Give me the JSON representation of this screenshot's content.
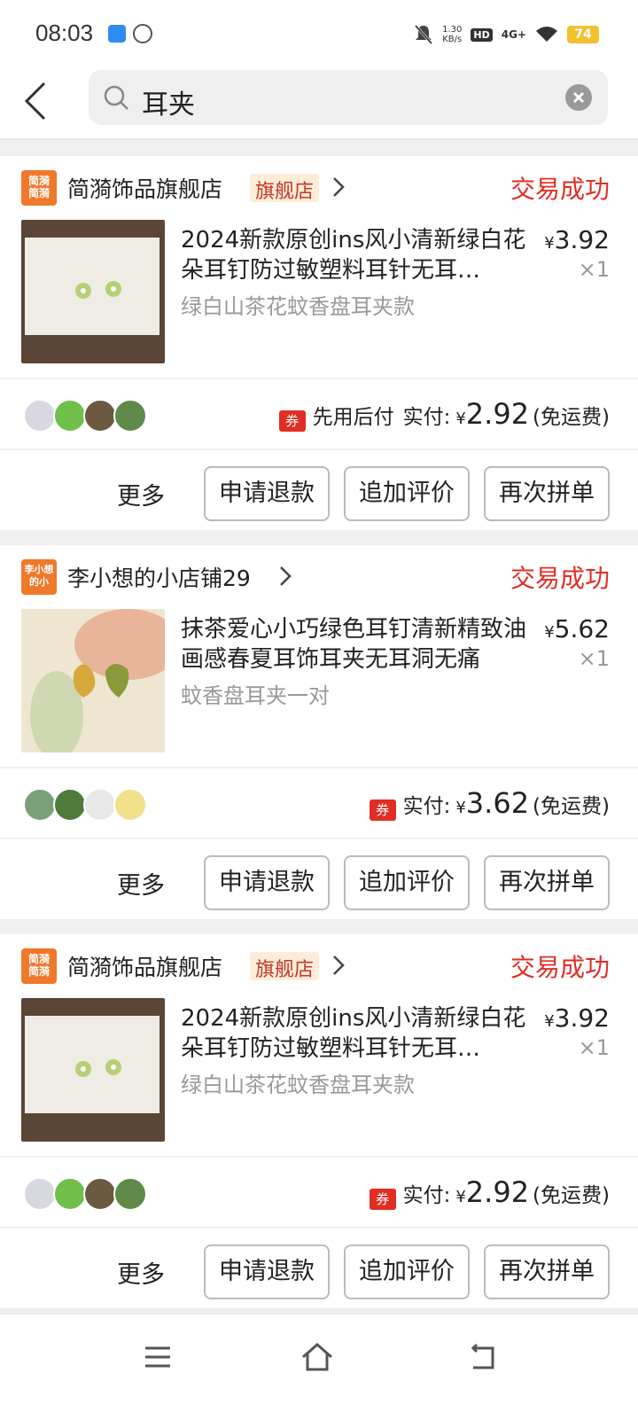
{
  "status_bar": {
    "time": "08:03",
    "net_speed_value": "1.30",
    "net_speed_unit": "KB/s",
    "hd": "HD",
    "network": "4G+",
    "battery": "74"
  },
  "header": {
    "search_text": "耳夹"
  },
  "orders": [
    {
      "shop_logo_text": "简漪简漪",
      "shop_name": "简漪饰品旗舰店",
      "badge": "旗舰店",
      "status": "交易成功",
      "title": "2024新款原创ins风小清新绿白花朵耳钉防过敏塑料耳针无耳…",
      "spec": "绿白山茶花蚊香盘耳夹款",
      "price": "3.92",
      "currency": "¥",
      "qty": "×1",
      "coupon": "券",
      "pay_later": "先用后付",
      "paid_label": "实付:",
      "paid_amount": "2.92",
      "free_shipping": "(免运费)"
    },
    {
      "shop_logo_text": "李小想的小",
      "shop_name": "李小想的小店铺29",
      "badge": "",
      "status": "交易成功",
      "title": "抹茶爱心小巧绿色耳钉清新精致油画感春夏耳饰耳夹无耳洞无痛",
      "spec": "蚊香盘耳夹一对",
      "price": "5.62",
      "currency": "¥",
      "qty": "×1",
      "coupon": "券",
      "pay_later": "",
      "paid_label": "实付:",
      "paid_amount": "3.62",
      "free_shipping": "(免运费)"
    },
    {
      "shop_logo_text": "简漪简漪",
      "shop_name": "简漪饰品旗舰店",
      "badge": "旗舰店",
      "status": "交易成功",
      "title": "2024新款原创ins风小清新绿白花朵耳钉防过敏塑料耳针无耳…",
      "spec": "绿白山茶花蚊香盘耳夹款",
      "price": "3.92",
      "currency": "¥",
      "qty": "×1",
      "coupon": "券",
      "pay_later": "",
      "paid_label": "实付:",
      "paid_amount": "2.92",
      "free_shipping": "(免运费)"
    }
  ],
  "actions": {
    "more": "更多",
    "refund": "申请退款",
    "add_review": "追加评价",
    "reorder": "再次拼单"
  },
  "colors": {
    "accent_red": "#e02e24",
    "shop_logo": "#f0782a",
    "battery": "#f2c12e"
  }
}
